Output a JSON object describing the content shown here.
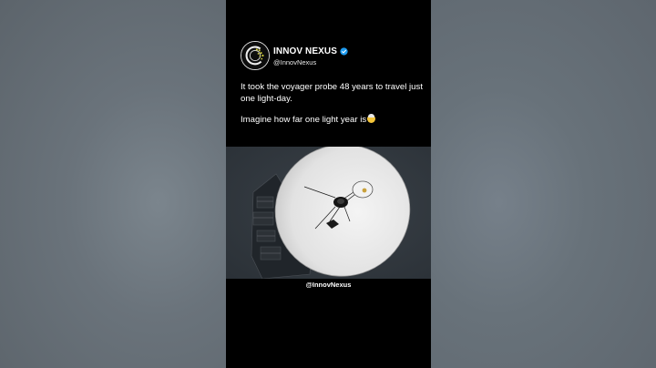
{
  "post": {
    "display_name": "INNOV NEXUS",
    "handle": "@InnovNexus",
    "verified_icon": "verified-badge-icon",
    "text_line_1": "It took the voyager probe 48 years to travel just one light-day.",
    "text_line_2": "Imagine how far one light year is",
    "emoji": "exploding-head-emoji",
    "media": "voyager-probe-dish-image",
    "watermark": "@InnovNexus"
  },
  "colors": {
    "background": "#000000",
    "text": "#ffffff",
    "verified_blue": "#1d9bf0",
    "avatar_accent": "#d8d640"
  }
}
